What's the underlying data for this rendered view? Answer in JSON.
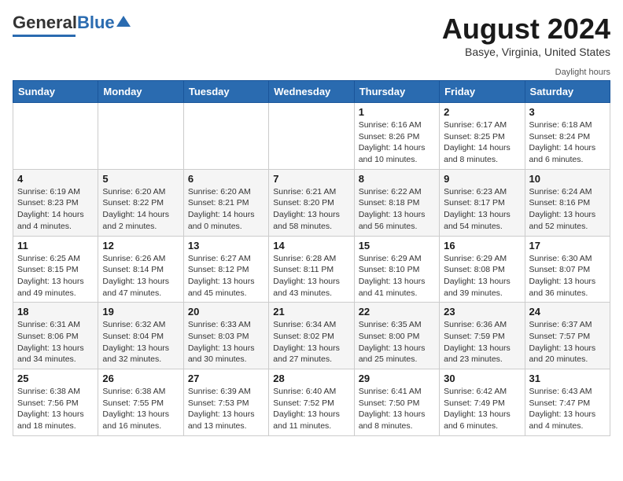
{
  "header": {
    "logo_general": "General",
    "logo_blue": "Blue",
    "month_year": "August 2024",
    "location": "Basye, Virginia, United States",
    "legend": "Daylight hours"
  },
  "days_of_week": [
    "Sunday",
    "Monday",
    "Tuesday",
    "Wednesday",
    "Thursday",
    "Friday",
    "Saturday"
  ],
  "weeks": [
    [
      {
        "day": "",
        "info": ""
      },
      {
        "day": "",
        "info": ""
      },
      {
        "day": "",
        "info": ""
      },
      {
        "day": "",
        "info": ""
      },
      {
        "day": "1",
        "info": "Sunrise: 6:16 AM\nSunset: 8:26 PM\nDaylight: 14 hours\nand 10 minutes."
      },
      {
        "day": "2",
        "info": "Sunrise: 6:17 AM\nSunset: 8:25 PM\nDaylight: 14 hours\nand 8 minutes."
      },
      {
        "day": "3",
        "info": "Sunrise: 6:18 AM\nSunset: 8:24 PM\nDaylight: 14 hours\nand 6 minutes."
      }
    ],
    [
      {
        "day": "4",
        "info": "Sunrise: 6:19 AM\nSunset: 8:23 PM\nDaylight: 14 hours\nand 4 minutes."
      },
      {
        "day": "5",
        "info": "Sunrise: 6:20 AM\nSunset: 8:22 PM\nDaylight: 14 hours\nand 2 minutes."
      },
      {
        "day": "6",
        "info": "Sunrise: 6:20 AM\nSunset: 8:21 PM\nDaylight: 14 hours\nand 0 minutes."
      },
      {
        "day": "7",
        "info": "Sunrise: 6:21 AM\nSunset: 8:20 PM\nDaylight: 13 hours\nand 58 minutes."
      },
      {
        "day": "8",
        "info": "Sunrise: 6:22 AM\nSunset: 8:18 PM\nDaylight: 13 hours\nand 56 minutes."
      },
      {
        "day": "9",
        "info": "Sunrise: 6:23 AM\nSunset: 8:17 PM\nDaylight: 13 hours\nand 54 minutes."
      },
      {
        "day": "10",
        "info": "Sunrise: 6:24 AM\nSunset: 8:16 PM\nDaylight: 13 hours\nand 52 minutes."
      }
    ],
    [
      {
        "day": "11",
        "info": "Sunrise: 6:25 AM\nSunset: 8:15 PM\nDaylight: 13 hours\nand 49 minutes."
      },
      {
        "day": "12",
        "info": "Sunrise: 6:26 AM\nSunset: 8:14 PM\nDaylight: 13 hours\nand 47 minutes."
      },
      {
        "day": "13",
        "info": "Sunrise: 6:27 AM\nSunset: 8:12 PM\nDaylight: 13 hours\nand 45 minutes."
      },
      {
        "day": "14",
        "info": "Sunrise: 6:28 AM\nSunset: 8:11 PM\nDaylight: 13 hours\nand 43 minutes."
      },
      {
        "day": "15",
        "info": "Sunrise: 6:29 AM\nSunset: 8:10 PM\nDaylight: 13 hours\nand 41 minutes."
      },
      {
        "day": "16",
        "info": "Sunrise: 6:29 AM\nSunset: 8:08 PM\nDaylight: 13 hours\nand 39 minutes."
      },
      {
        "day": "17",
        "info": "Sunrise: 6:30 AM\nSunset: 8:07 PM\nDaylight: 13 hours\nand 36 minutes."
      }
    ],
    [
      {
        "day": "18",
        "info": "Sunrise: 6:31 AM\nSunset: 8:06 PM\nDaylight: 13 hours\nand 34 minutes."
      },
      {
        "day": "19",
        "info": "Sunrise: 6:32 AM\nSunset: 8:04 PM\nDaylight: 13 hours\nand 32 minutes."
      },
      {
        "day": "20",
        "info": "Sunrise: 6:33 AM\nSunset: 8:03 PM\nDaylight: 13 hours\nand 30 minutes."
      },
      {
        "day": "21",
        "info": "Sunrise: 6:34 AM\nSunset: 8:02 PM\nDaylight: 13 hours\nand 27 minutes."
      },
      {
        "day": "22",
        "info": "Sunrise: 6:35 AM\nSunset: 8:00 PM\nDaylight: 13 hours\nand 25 minutes."
      },
      {
        "day": "23",
        "info": "Sunrise: 6:36 AM\nSunset: 7:59 PM\nDaylight: 13 hours\nand 23 minutes."
      },
      {
        "day": "24",
        "info": "Sunrise: 6:37 AM\nSunset: 7:57 PM\nDaylight: 13 hours\nand 20 minutes."
      }
    ],
    [
      {
        "day": "25",
        "info": "Sunrise: 6:38 AM\nSunset: 7:56 PM\nDaylight: 13 hours\nand 18 minutes."
      },
      {
        "day": "26",
        "info": "Sunrise: 6:38 AM\nSunset: 7:55 PM\nDaylight: 13 hours\nand 16 minutes."
      },
      {
        "day": "27",
        "info": "Sunrise: 6:39 AM\nSunset: 7:53 PM\nDaylight: 13 hours\nand 13 minutes."
      },
      {
        "day": "28",
        "info": "Sunrise: 6:40 AM\nSunset: 7:52 PM\nDaylight: 13 hours\nand 11 minutes."
      },
      {
        "day": "29",
        "info": "Sunrise: 6:41 AM\nSunset: 7:50 PM\nDaylight: 13 hours\nand 8 minutes."
      },
      {
        "day": "30",
        "info": "Sunrise: 6:42 AM\nSunset: 7:49 PM\nDaylight: 13 hours\nand 6 minutes."
      },
      {
        "day": "31",
        "info": "Sunrise: 6:43 AM\nSunset: 7:47 PM\nDaylight: 13 hours\nand 4 minutes."
      }
    ]
  ]
}
